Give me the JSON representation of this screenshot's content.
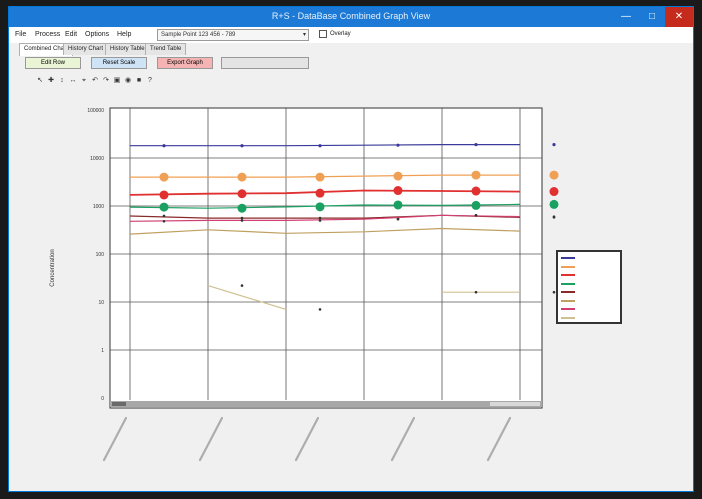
{
  "window": {
    "title": "R+S - DataBase Combined Graph View",
    "min_glyph": "—",
    "max_glyph": "□",
    "close_glyph": "✕"
  },
  "menu": {
    "items": [
      "File",
      "Process",
      "Edit",
      "Options",
      "Help"
    ],
    "select_value": "Sample Point 123 456 - 789",
    "select_arrow": "▾",
    "checkbox_label": "Overlay"
  },
  "tabs": [
    "Combined Chart",
    "History Chart",
    "History Table",
    "Trend Table"
  ],
  "action_buttons": [
    {
      "label": "Edit Row",
      "bg": "#eaf5d6"
    },
    {
      "label": "Reset Scale",
      "bg": "#cfe3f7"
    },
    {
      "label": "Export Graph",
      "bg": "#f5b3b3"
    }
  ],
  "toolbar": [
    "↖",
    "✚",
    "↕",
    "↔",
    "⌖",
    "↶",
    "↷",
    "▣",
    "◉",
    "■",
    "?"
  ],
  "colors": {
    "accent": "#1c7ad6",
    "series": [
      "#3a3a9a",
      "#f0a055",
      "#e03030",
      "#1aa060",
      "#8a2a2a",
      "#c0a060",
      "#d04070",
      "#d0c090",
      "#a06020"
    ]
  },
  "chart_data": {
    "type": "line",
    "ylabel": "Concentration",
    "yscale": "log",
    "ylim": [
      1,
      100000
    ],
    "yticks": [
      "100000",
      "10000",
      "1000",
      "100",
      "10",
      "1",
      "0"
    ],
    "categories": [
      "",
      "",
      "",
      "",
      ""
    ],
    "grid": true,
    "legend_position": "right",
    "series": [
      {
        "name": "",
        "values": [
          18000,
          18000,
          18000,
          18500,
          19000,
          19000
        ],
        "marker": "dot"
      },
      {
        "name": "",
        "values": [
          4000,
          4000,
          4000,
          4200,
          4400,
          4400
        ],
        "marker": "big"
      },
      {
        "name": "",
        "values": [
          1700,
          1800,
          1850,
          2100,
          2050,
          2000
        ],
        "marker": "big"
      },
      {
        "name": "",
        "values": [
          950,
          900,
          960,
          1050,
          1030,
          1080
        ],
        "marker": "big"
      },
      {
        "name": "",
        "values": [
          620,
          560,
          560,
          560,
          640,
          580
        ],
        "marker": "small"
      },
      {
        "name": "",
        "values": [
          260,
          320,
          270,
          290,
          340,
          300
        ],
        "marker": "none"
      },
      {
        "name": "",
        "values": [
          480,
          500,
          500,
          530,
          640,
          600
        ],
        "marker": "small"
      },
      {
        "name": "",
        "values": [
          null,
          22,
          7,
          null,
          16,
          16
        ],
        "marker": "small"
      }
    ]
  }
}
